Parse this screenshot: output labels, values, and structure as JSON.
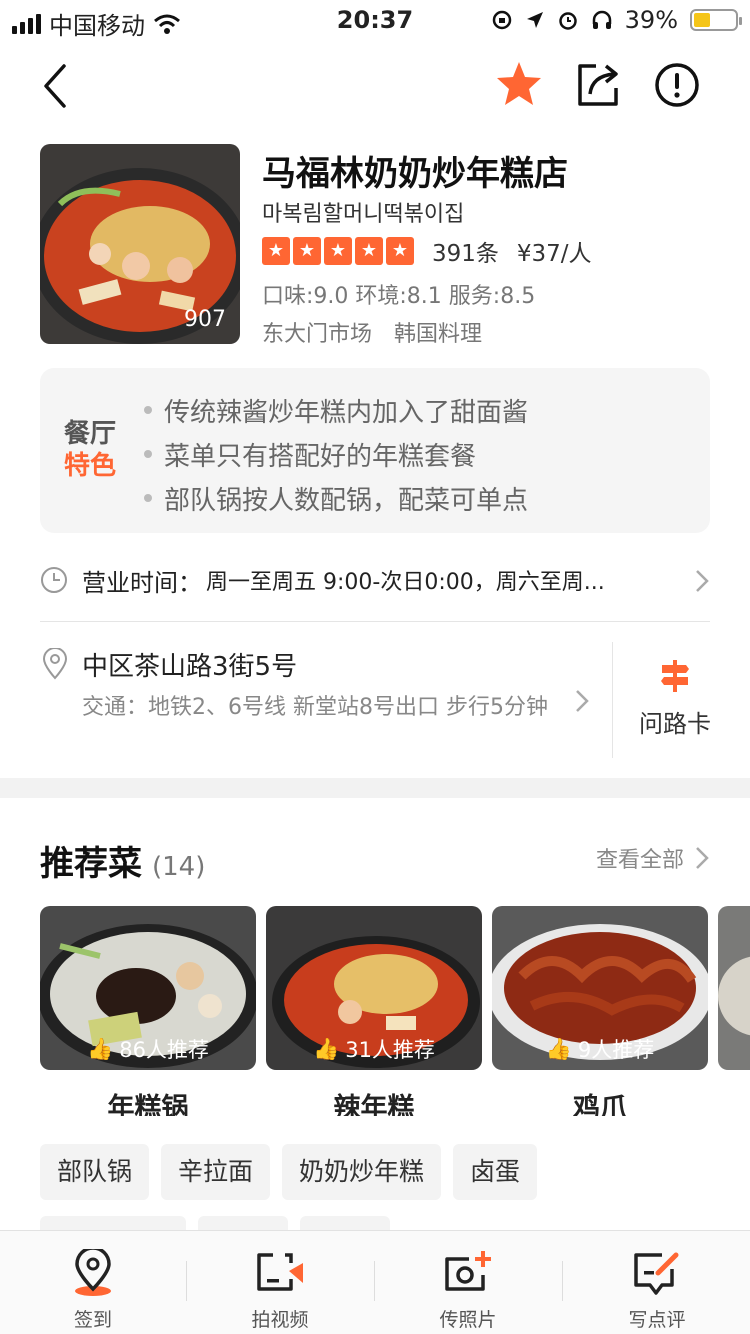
{
  "status_bar": {
    "carrier": "中国移动",
    "time": "20:37",
    "battery": "39%",
    "battery_level": 0.39
  },
  "shop": {
    "name": "马福林奶奶炒年糕店",
    "korean_name": "마복림할머니떡볶이집",
    "photo_count": "907",
    "star_rating": 5,
    "reviews": "391条",
    "price": "¥37/人",
    "scores": "口味:9.0 环境:8.1 服务:8.5",
    "tags": [
      "东大门市场",
      "韩国料理"
    ]
  },
  "features": {
    "badge_line1": "餐厅",
    "badge_line2": "特色",
    "items": [
      "传统辣酱炒年糕内加入了甜面酱",
      "菜单只有搭配好的年糕套餐",
      "部队锅按人数配锅，配菜可单点"
    ]
  },
  "hours": {
    "label": "营业时间：",
    "value": "周一至周五 9:00-次日0:00，周六至周..."
  },
  "address": {
    "main": "中区茶山路3街5号",
    "transit": "交通：地铁2、6号线 新堂站8号出口 步行5分钟",
    "route_card": "问路卡"
  },
  "dishes": {
    "title": "推荐菜",
    "count": "(14)",
    "see_all": "查看全部",
    "cards": [
      {
        "name": "年糕锅",
        "recommend": "86人推荐"
      },
      {
        "name": "辣年糕",
        "recommend": "31人推荐"
      },
      {
        "name": "鸡爪",
        "recommend": "9人推荐"
      }
    ],
    "chips": [
      "部队锅",
      "辛拉面",
      "奶奶炒年糕",
      "卤蛋"
    ]
  },
  "tabbar": {
    "checkin": "签到",
    "video": "拍视频",
    "photo": "传照片",
    "review": "写点评"
  },
  "colors": {
    "accent": "#ff6633",
    "text": "#222222",
    "muted": "#888888"
  }
}
